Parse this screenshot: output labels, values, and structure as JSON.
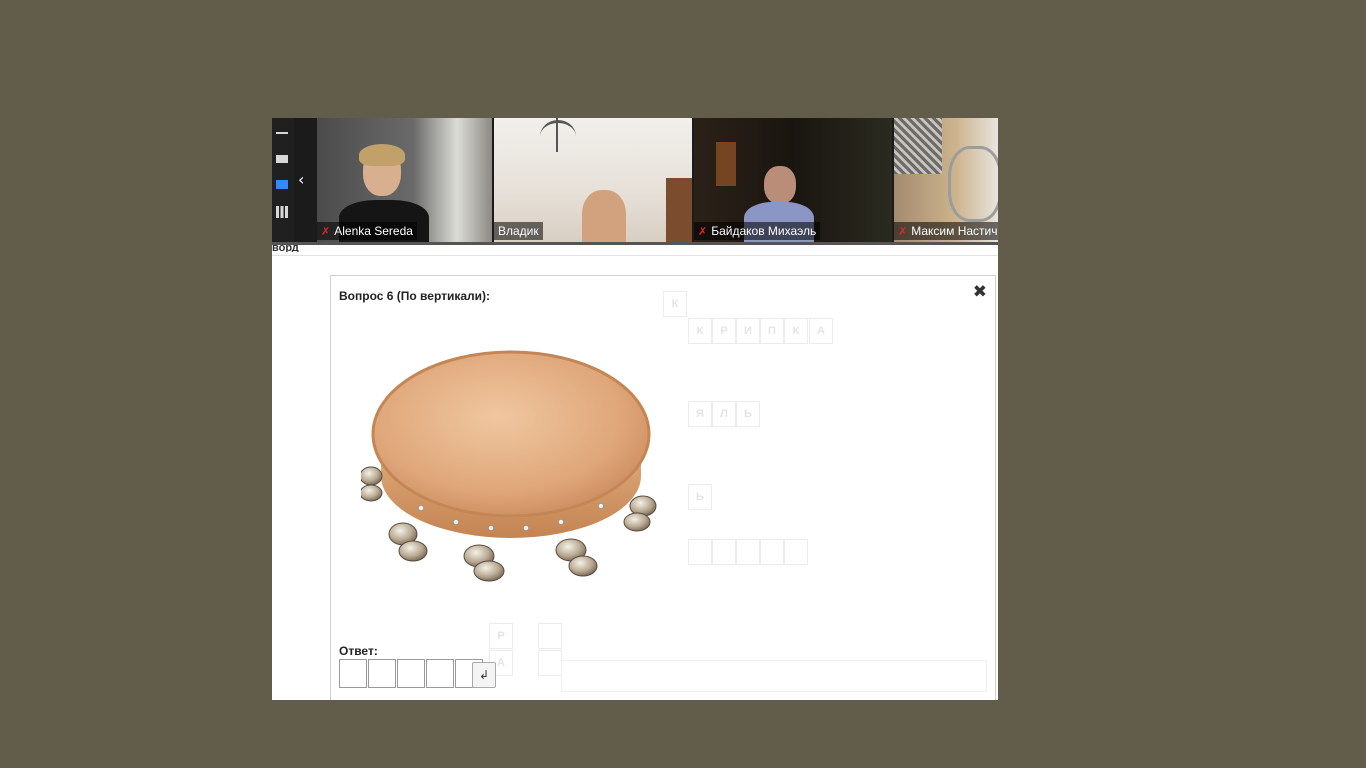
{
  "participants": [
    {
      "name": "Alenka Sereda",
      "muted": true
    },
    {
      "name": "Владик",
      "muted": false
    },
    {
      "name": "Байдаков Михаэль",
      "muted": true
    },
    {
      "name": "Максим Настич",
      "muted": true
    }
  ],
  "page": {
    "header_fragment": "ворд"
  },
  "question": {
    "title": "Вопрос 6 (По вертикали):",
    "answer_label": "Ответ:",
    "answer_length": 5,
    "submit_symbol": "↲",
    "close_symbol": "✖"
  },
  "crossword_background": {
    "row1": [
      "К"
    ],
    "row2": [
      "К",
      "Р",
      "И",
      "П",
      "К",
      "А"
    ],
    "row3": [
      "Я",
      "Л",
      "Ь"
    ],
    "row4": [
      "Ь"
    ],
    "row5": [
      "Р",
      "А"
    ]
  },
  "colors": {
    "backdrop": "#625c4b",
    "accent": "#2d8cff",
    "mic_off": "#e0262b"
  }
}
